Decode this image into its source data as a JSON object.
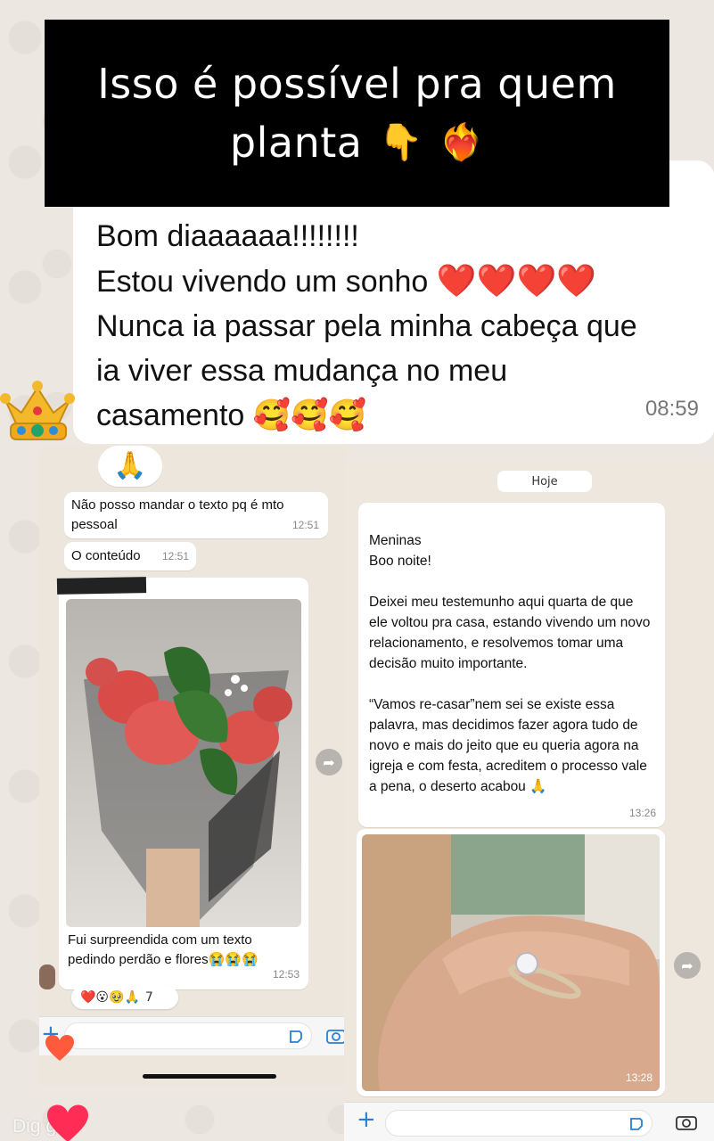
{
  "caption": {
    "line1": "Isso é possível pra quem",
    "line2": "planta",
    "emojis": [
      "👇",
      "❤️‍🔥"
    ]
  },
  "big_message": {
    "line1": "Bom diaaaaaa!!!!!!!!",
    "line2": "Estou vivendo um sonho",
    "hearts": "❤️❤️❤️❤️",
    "line3": "Nunca ia passar pela minha cabeça que",
    "line4": "ia viver essa mudança no meu",
    "line5": "casamento",
    "smileys": "🥰🥰🥰",
    "time": "08:59"
  },
  "left_chat": {
    "pray_emoji": "🙏",
    "msg1": {
      "text": "Não posso mandar o texto pq é mto pessoal",
      "time": "12:51"
    },
    "msg2": {
      "text": "O conteúdo",
      "time": "12:51"
    },
    "photo_msg": {
      "caption": "Fui surpreendida com um texto pedindo perdão e flores😭😭😭",
      "time": "12:53"
    },
    "reactions": {
      "emojis": "❤️😮🥹🙏",
      "count": "7"
    }
  },
  "right_chat": {
    "date_label": "Hoje",
    "message": "Meninas\nBoo noite!\n\nDeixei meu testemunho aqui quarta de que ele voltou pra casa, estando vivendo um novo relacionamento, e resolvemos tomar uma decisão muito importante.\n\n“Vamos re-casar”nem sei se existe essa palavra, mas decidimos fazer agora tudo de novo e mais do jeito que eu queria agora na igreja e com festa, acreditem o processo vale a pena, o deserto acabou 🙏",
    "message_time": "13:26",
    "photo_time": "13:28"
  },
  "bottom_text": "Dig    go...",
  "colors": {
    "heart": "#ff2d55",
    "accent_blue": "#2a7fd4",
    "caption_bg": "#000000"
  },
  "icons": [
    "crown-icon",
    "forward-icon",
    "sticker-icon",
    "camera-icon",
    "plus-icon",
    "heart-icon"
  ]
}
